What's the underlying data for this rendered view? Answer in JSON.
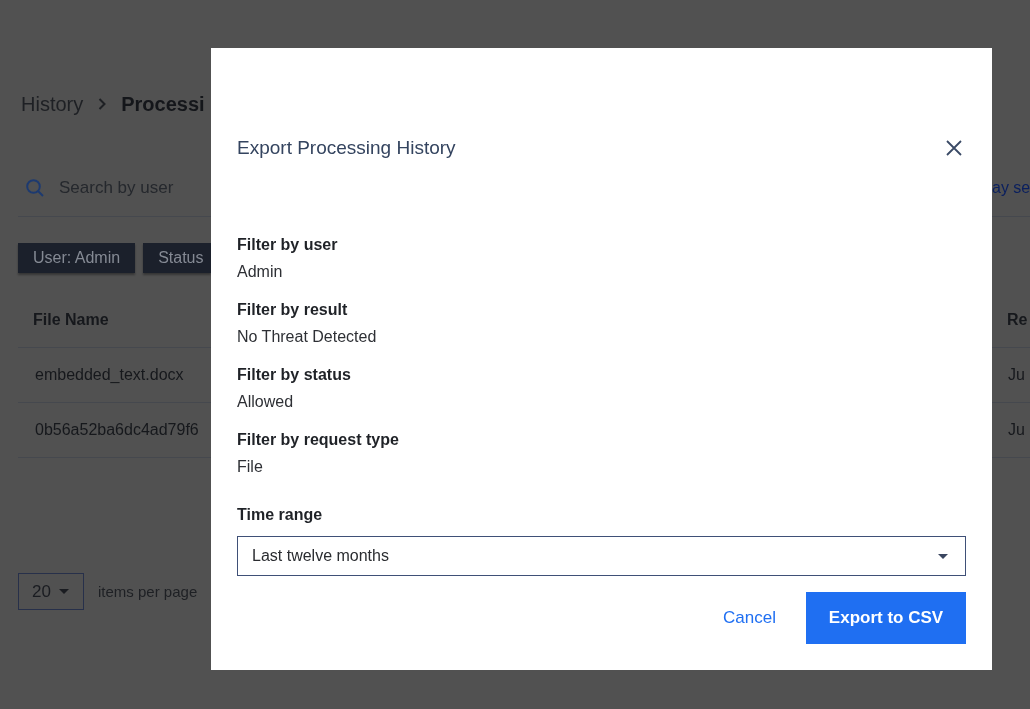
{
  "breadcrumb": [
    {
      "label": "History",
      "current": false
    },
    {
      "label": "Processi",
      "current": true
    }
  ],
  "search": {
    "placeholder": "Search by user"
  },
  "toolbar_link": "ay se",
  "filter_chips": [
    {
      "label": "User: Admin"
    },
    {
      "label": "Status"
    }
  ],
  "table": {
    "columns": [
      "File Name",
      "Re"
    ],
    "rows": [
      [
        "embedded_text.docx",
        "Ju"
      ],
      [
        "0b56a52ba6dc4ad79f6",
        "Ju"
      ]
    ]
  },
  "pagination": {
    "page_size": "20",
    "label": "items per page"
  },
  "dialog": {
    "title": "Export Processing History",
    "filters": [
      {
        "label": "Filter by user",
        "value": "Admin"
      },
      {
        "label": "Filter by result",
        "value": "No Threat Detected"
      },
      {
        "label": "Filter by status",
        "value": "Allowed"
      },
      {
        "label": "Filter by request type",
        "value": "File"
      }
    ],
    "time_range": {
      "label": "Time range",
      "value": "Last twelve months"
    },
    "buttons": [
      {
        "label": "Cancel",
        "kind": "link"
      },
      {
        "label": "Export to CSV",
        "kind": "primary"
      }
    ]
  }
}
